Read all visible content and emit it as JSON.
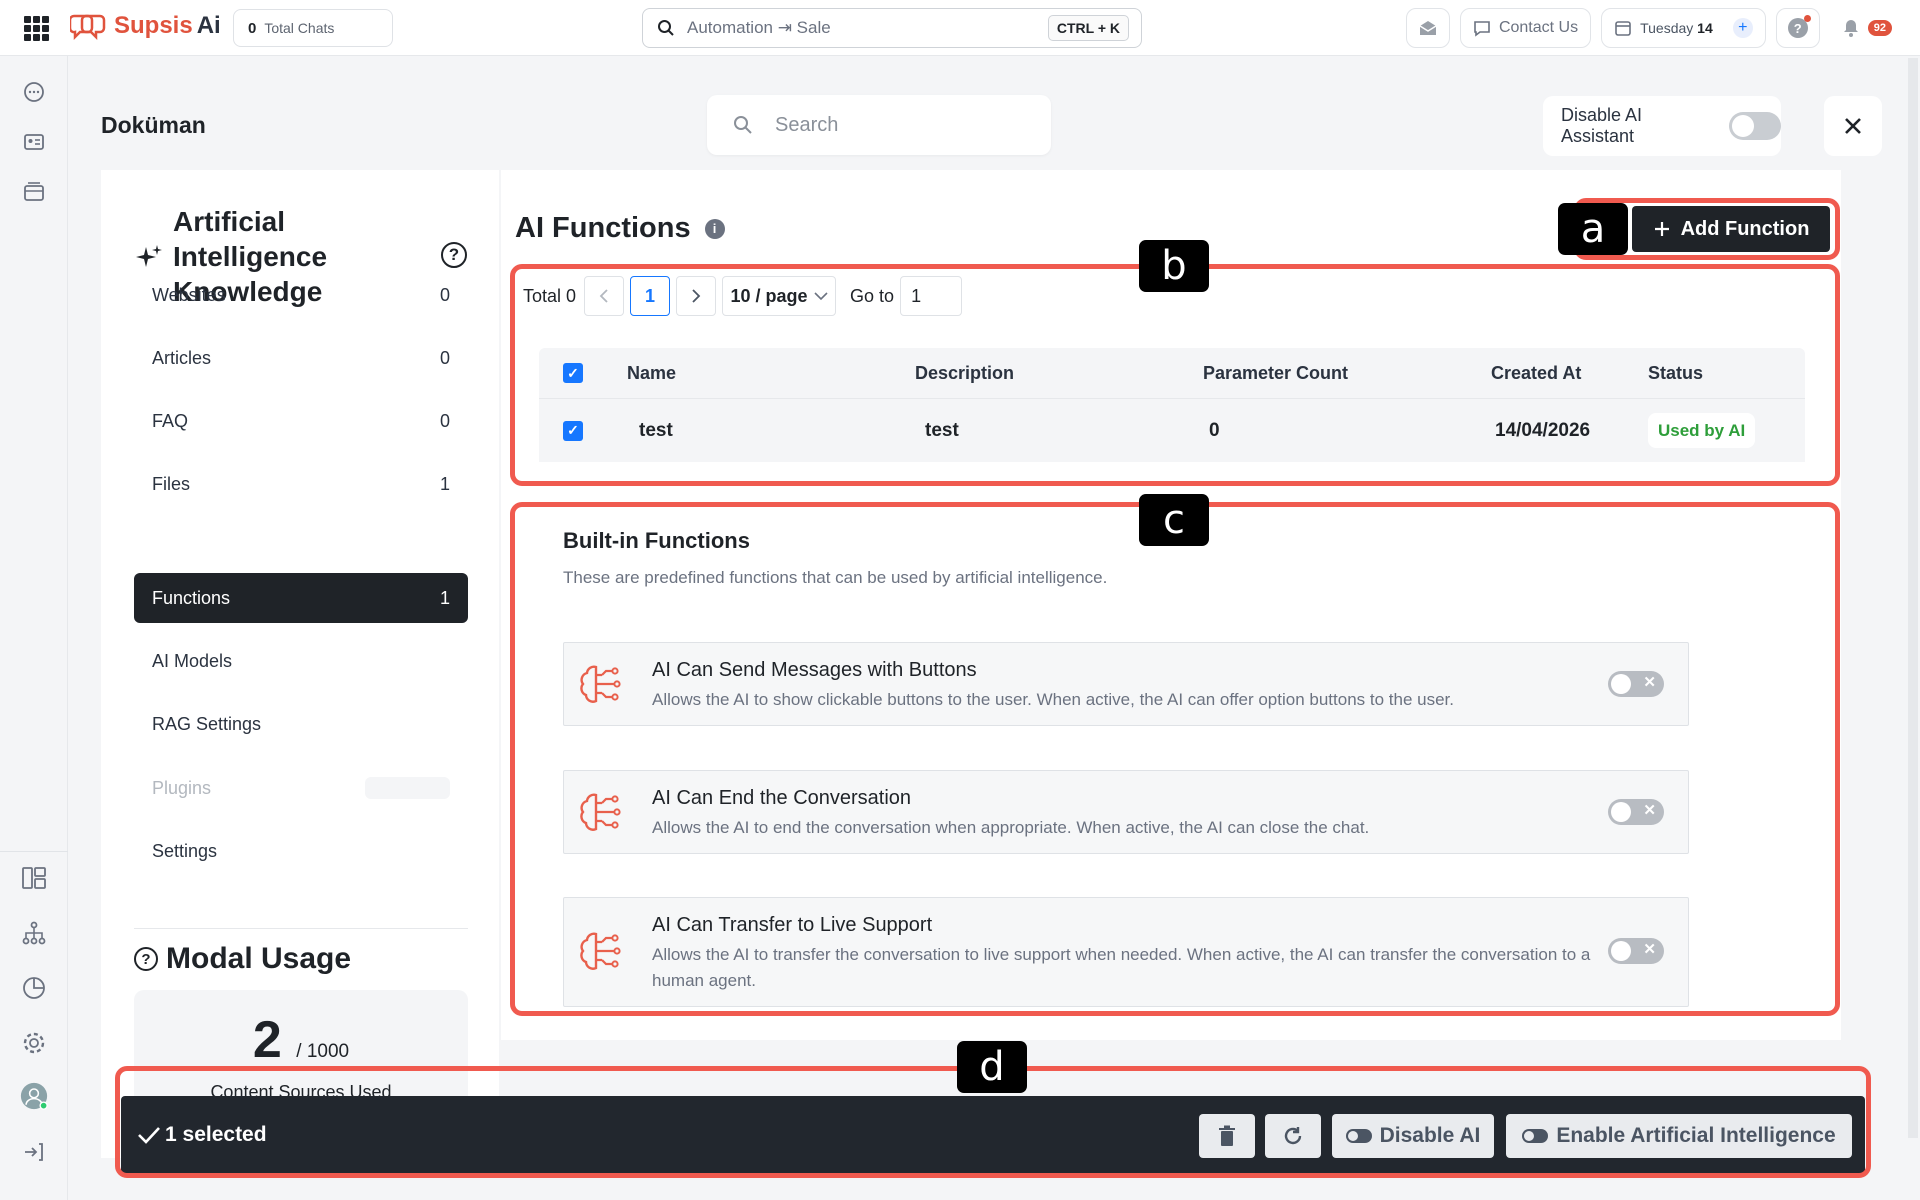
{
  "app": {
    "brand": "Supsis",
    "brand_suffix": "Ai",
    "total_chats_count": "0",
    "total_chats_label": "Total Chats",
    "search_placeholder": "Automation ⇥ Sale",
    "search_shortcut": "CTRL + K",
    "contact_label": "Contact Us",
    "date_day": "Tuesday",
    "date_num": "14",
    "notification_count": "92"
  },
  "page": {
    "title": "Doküman",
    "search_placeholder": "Search",
    "disable_ai_label": "Disable AI Assistant"
  },
  "sidebar": {
    "title": "Artificial Intelligence Knowledge",
    "items": [
      {
        "label": "Websites",
        "count": "0"
      },
      {
        "label": "Articles",
        "count": "0"
      },
      {
        "label": "FAQ",
        "count": "0"
      },
      {
        "label": "Files",
        "count": "1"
      },
      {
        "label": "Functions",
        "count": "1"
      },
      {
        "label": "AI Models",
        "count": ""
      },
      {
        "label": "RAG Settings",
        "count": ""
      },
      {
        "label": "Plugins",
        "count": ""
      },
      {
        "label": "Settings",
        "count": ""
      }
    ],
    "usage_title": "Modal Usage",
    "usage_used": "2",
    "usage_total": "/ 1000",
    "usage_label": "Content Sources Used"
  },
  "functions": {
    "title": "AI Functions",
    "add_label": "Add Function",
    "pager": {
      "total": "Total 0",
      "current_page": "1",
      "page_size": "10 / page",
      "goto_label": "Go to",
      "goto_value": "1"
    },
    "columns": [
      "Name",
      "Description",
      "Parameter Count",
      "Created At",
      "Status"
    ],
    "rows": [
      {
        "name": "test",
        "description": "test",
        "param_count": "0",
        "created_at": "14/04/2026",
        "status": "Used by AI"
      }
    ]
  },
  "builtin": {
    "title": "Built-in Functions",
    "subtitle": "These are predefined functions that can be used by artificial intelligence.",
    "items": [
      {
        "title": "AI Can Send Messages with Buttons",
        "desc": "Allows the AI to show clickable buttons to the user. When active, the AI can offer option buttons to the user.",
        "enabled": false
      },
      {
        "title": "AI Can End the Conversation",
        "desc": "Allows the AI to end the conversation when appropriate. When active, the AI can close the chat.",
        "enabled": false
      },
      {
        "title": "AI Can Transfer to Live Support",
        "desc": "Allows the AI to transfer the conversation to live support when needed. When active, the AI can transfer the conversation to a human agent.",
        "enabled": false
      }
    ]
  },
  "action_bar": {
    "selected_label": "1 selected",
    "disable_label": "Disable AI",
    "enable_label": "Enable Artificial Intelligence"
  },
  "annotations": {
    "a": "a",
    "b": "b",
    "c": "c",
    "d": "d"
  },
  "colors": {
    "accent": "#e0533d",
    "annotation": "#f05a4f",
    "primary_dark": "#1f2328",
    "status_green": "#2e9e3a",
    "link_blue": "#1677ff"
  }
}
